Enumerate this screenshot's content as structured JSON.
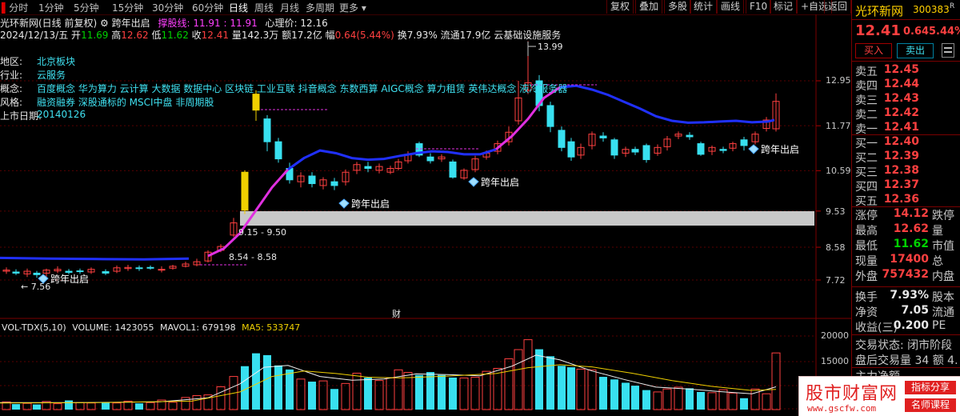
{
  "toolbar": {
    "items": [
      "分时",
      "1分钟",
      "5分钟",
      "15分钟",
      "30分钟",
      "60分钟",
      "日线",
      "周线",
      "月线",
      "多周期",
      "更多"
    ],
    "buttons": [
      "复权",
      "叠加",
      "多股",
      "统计",
      "画线",
      "F10",
      "标记",
      "+自选",
      "返回"
    ]
  },
  "header": {
    "stock_title": "光环新网(日线 前复权)",
    "indicator_name": "跨年出启",
    "support_label": "撑股线:",
    "support_values": "11.91 : 11.91",
    "psych_label": "心理价:",
    "psych_value": "12.16"
  },
  "quote_line": {
    "date": "2024/12/13/五",
    "open_label": "开",
    "open": "11.69",
    "high_label": "高",
    "high": "12.62",
    "low_label": "低",
    "low": "11.62",
    "close_label": "收",
    "close": "12.41",
    "vol_label": "量",
    "vol": "142.3万",
    "amt_label": "额",
    "amt": "17.2亿",
    "chg_label": "幅",
    "chg": "0.64(5.44%)",
    "turnover": "换7.93%",
    "float": "流通17.9亿",
    "industry": "云基础设施服务"
  },
  "info_panel": [
    {
      "label": "地区:",
      "value": "北京板块"
    },
    {
      "label": "行业:",
      "value": "云服务"
    },
    {
      "label": "概念:",
      "value": "百度概念 华为算力 云计算 大数据 数据中心 区块链 工业互联 抖音概念 东数西算 AIGC概念 算力租赁 英伟达概念 液冷服务器"
    },
    {
      "label": "风格:",
      "value": "融资融券 深股通标的 MSCI中盘 非周期股"
    },
    {
      "label": "上市日期:",
      "value": "20140126"
    }
  ],
  "annotations": {
    "high_price": "13.99",
    "low_price": "7.56",
    "range1": "9.15 - 9.50",
    "range2": "8.54 - 8.58",
    "signal": "跨年出启",
    "fin_marker": "财"
  },
  "price_axis": [
    "12.95",
    "11.77",
    "10.59",
    "9.53",
    "8.58",
    "7.72"
  ],
  "volume_axis": [
    "20000",
    "15000",
    "10000",
    "5000"
  ],
  "volume_header": {
    "name": "VOL-TDX(5,10)",
    "vol": "VOLUME: 1423055",
    "mavol1": "MAVOL1: 679198",
    "ma5": "MA5: 533747"
  },
  "right_panel": {
    "name": "光环新网",
    "code": "300383",
    "badge": "R",
    "price": "12.41",
    "change": "0.64",
    "change_pct": "5.44%",
    "buy_btn": "买入",
    "sell_btn": "卖出",
    "sells": [
      {
        "label": "卖五",
        "price": "12.45"
      },
      {
        "label": "卖四",
        "price": "12.44"
      },
      {
        "label": "卖三",
        "price": "12.43"
      },
      {
        "label": "卖二",
        "price": "12.42"
      },
      {
        "label": "卖一",
        "price": "12.41"
      }
    ],
    "buys": [
      {
        "label": "买一",
        "price": "12.40"
      },
      {
        "label": "买二",
        "price": "12.39"
      },
      {
        "label": "买三",
        "price": "12.38"
      },
      {
        "label": "买四",
        "price": "12.37"
      },
      {
        "label": "买五",
        "price": "12.36"
      }
    ],
    "stats": [
      {
        "label": "涨停",
        "value": "14.12",
        "suffix": "跌停"
      },
      {
        "label": "最高",
        "value": "12.62",
        "suffix": "量"
      },
      {
        "label": "最低",
        "value": "11.62",
        "suffix": "市值"
      },
      {
        "label": "现量",
        "value": "17400",
        "suffix": "总"
      },
      {
        "label": "外盘",
        "value": "757432",
        "suffix": "内盘"
      }
    ],
    "stats2": [
      {
        "label": "换手",
        "value": "7.93%",
        "suffix": "股本"
      },
      {
        "label": "净资",
        "value": "7.05",
        "suffix": "流通"
      },
      {
        "label": "收益(三)",
        "value": "0.200",
        "suffix": "PE"
      }
    ],
    "trade_status": "交易状态: 闭市阶段",
    "after_hours": "盘后交易量 34 额 4.",
    "main_force": "主力净额"
  },
  "watermark": {
    "title": "股市财富网",
    "url": "www.gscfw.com",
    "tag1": "指标分享",
    "tag2": "名师课程"
  },
  "colors": {
    "up": "#ff4040",
    "down": "#38e0f0",
    "ma_blue": "#2030ff",
    "ma_magenta": "#e030e0",
    "yellow_bar": "#f0d000",
    "gray_zone": "#c8c8c8"
  }
}
